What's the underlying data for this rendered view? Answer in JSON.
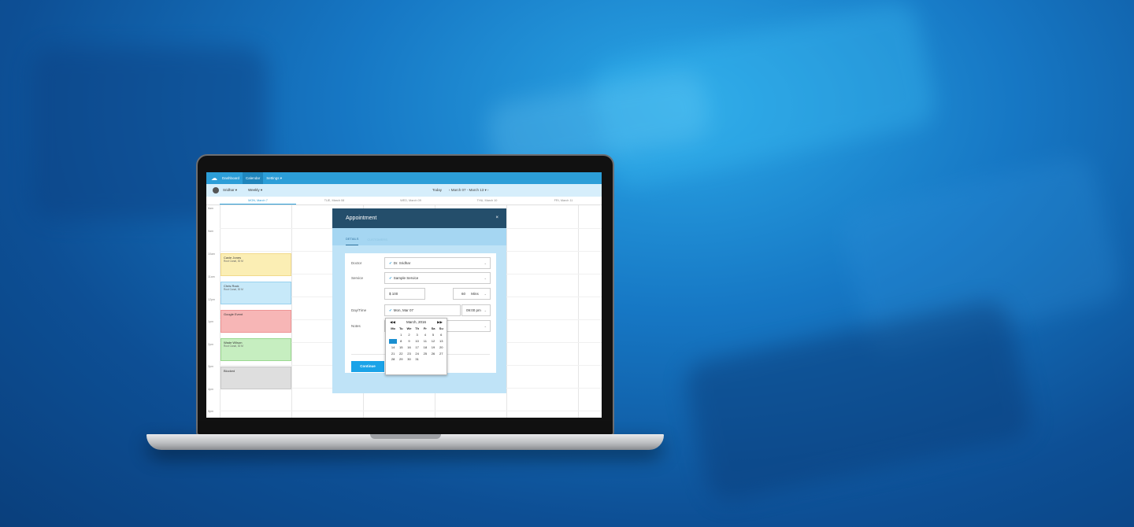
{
  "nav": {
    "items": [
      {
        "label": "Dashboard",
        "active": false
      },
      {
        "label": "Calendar",
        "active": true
      },
      {
        "label": "Settings ▾",
        "active": false
      }
    ]
  },
  "subbar": {
    "doctor_dropdown": "Sridhar ▾",
    "view_dropdown": "Weekly ▾",
    "today_label": "Today",
    "date_range": "‹   March 07 - March 13 ▾   ›"
  },
  "days": [
    "MON, March 7",
    "TUE, March 08",
    "WED, March 09",
    "THU, March 10",
    "FRI, March 11"
  ],
  "times": [
    "8am",
    "9am",
    "10am",
    "11am",
    "12pm",
    "1pm",
    "2pm",
    "3pm",
    "4pm",
    "5pm"
  ],
  "events": [
    {
      "title": "Cavie Jones",
      "sub": "Root Canal, 30 M"
    },
    {
      "title": "Chris Rock",
      "sub": "Root Canal, 30 M"
    },
    {
      "title": "Google Event",
      "sub": ""
    },
    {
      "title": "Wade Wilson",
      "sub": "Root Canal, 30 M"
    },
    {
      "title": "Blocked",
      "sub": ""
    }
  ],
  "modal": {
    "title": "Appointment",
    "close": "×",
    "tabs": [
      "DETAILS",
      "CUSTOMERS"
    ],
    "labels": {
      "doctor": "Doctor",
      "service": "Service",
      "datetime": "Day/Time",
      "notes": "Notes"
    },
    "doctor_value": "Dr. Sridhar",
    "service_value": "Sample Service",
    "price_value": "$ 100",
    "duration_value": "60",
    "duration_unit": "Mins",
    "date_value": "Mon, Mar 07",
    "time_value": "09:00 pm",
    "continue_label": "Continue"
  },
  "datepicker": {
    "month": "March, 2016",
    "prev": "◀◀",
    "next": "▶▶",
    "weekdays": [
      "Mo",
      "Tu",
      "We",
      "Th",
      "Fr",
      "Sa",
      "Su"
    ],
    "days": [
      "",
      "1",
      "2",
      "3",
      "4",
      "5",
      "6",
      "7",
      "8",
      "9",
      "10",
      "11",
      "12",
      "13",
      "14",
      "15",
      "16",
      "17",
      "18",
      "19",
      "20",
      "21",
      "22",
      "23",
      "24",
      "25",
      "26",
      "27",
      "28",
      "29",
      "30",
      "31",
      "",
      "",
      ""
    ],
    "selected": "7"
  },
  "colors": {
    "nav": "#2c9ed8",
    "modal_header": "#244e6b",
    "accent": "#1aa3e8"
  }
}
